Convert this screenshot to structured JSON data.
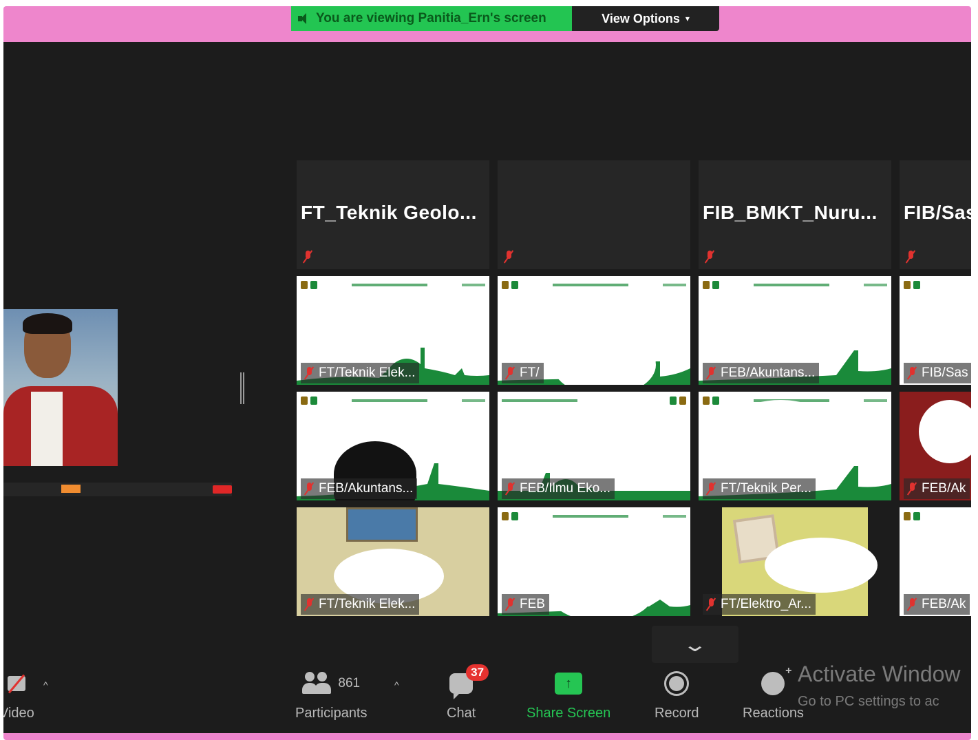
{
  "banner": {
    "viewing_text": "You are viewing Panitia_Ern's screen",
    "view_options_label": "View Options",
    "green": "#23c552"
  },
  "tiles": [
    {
      "name": "FT_Teknik  Geolo...",
      "type": "name-only"
    },
    {
      "name": "",
      "type": "name-only"
    },
    {
      "name": "FIB_BMKT_Nuru...",
      "type": "name-only"
    },
    {
      "name": "FIB/Sas",
      "type": "name-only"
    },
    {
      "label": "FT/Teknik Elek...",
      "type": "banner"
    },
    {
      "label": "FT/",
      "type": "banner"
    },
    {
      "label": "FEB/Akuntans...",
      "type": "banner"
    },
    {
      "label": "FIB/Sas",
      "type": "banner"
    },
    {
      "label": "FEB/Akuntans...",
      "type": "banner"
    },
    {
      "label": "FEB/Ilmu Eko...",
      "type": "banner"
    },
    {
      "label": "FT/Teknik Per...",
      "type": "banner"
    },
    {
      "label": "FEB/Ak",
      "type": "photo"
    },
    {
      "label": "FT/Teknik Elek...",
      "type": "photo"
    },
    {
      "label": "FEB",
      "type": "banner"
    },
    {
      "label": "FT/Elektro_Ar...",
      "type": "photo"
    },
    {
      "label": "FEB/Ak",
      "type": "banner"
    }
  ],
  "toolbar": {
    "video_label": "Video",
    "participants_label": "Participants",
    "participants_count": "861",
    "chat_label": "Chat",
    "chat_badge": "37",
    "share_label": "Share Screen",
    "record_label": "Record",
    "reactions_label": "Reactions"
  },
  "watermark": {
    "title": "Activate Window",
    "subtitle": "Go to PC settings to ac"
  },
  "colors": {
    "frame": "#ee86cc",
    "stage": "#1c1c1c",
    "accent_green": "#25c553",
    "badge_red": "#e6322f"
  }
}
